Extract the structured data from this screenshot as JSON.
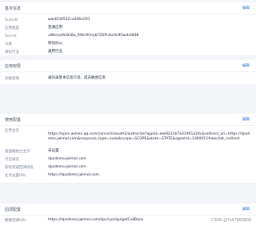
{
  "basic": {
    "title": "基本信息",
    "edit": "编辑",
    "rows": [
      {
        "label": "SuiteID",
        "value": "wwd0305S2ca046a591"
      },
      {
        "label": "应用类型",
        "value": "普通应用"
      },
      {
        "label": "Secret",
        "value": "uWerno9eDiiBo_ItWn9mnjkFZDPn4oHx9Ow4ct848"
      },
      {
        "label": "分类",
        "value": "移动办公"
      },
      {
        "label": "目标行业",
        "value": "通用行业"
      }
    ]
  },
  "permission": {
    "title": "应用权限",
    "edit": "编辑",
    "rows": [
      {
        "label": "功能权限",
        "value": "通讯录基本信息只读、成员敏感信息"
      }
    ]
  },
  "usage": {
    "title": "使用配置",
    "edit": "编辑",
    "rows": [
      {
        "label": "应用主页",
        "value": "https://open.weixin.qq.com/connect/oauth2/authorize?appid=ww9231b7a31901a24c&redirect_uri=https://dpsdemo.jwimol.com&response_type=code&scope=SCOPE&state=STATE&agentid=1000015#wechat_redirect"
      },
      {
        "label": "桌面端独立主页",
        "value": "未设置"
      },
      {
        "label": "可信域名",
        "value": "dpsdemo.jwimol.com"
      },
      {
        "label": "安装完成回调域名",
        "value": "dpsdemo.jwimol.com"
      },
      {
        "label": "业务设置URL",
        "value": "https://dpsdemo.jwimol.com"
      }
    ]
  },
  "callback": {
    "title": "回调配置",
    "edit": "编辑",
    "rows": [
      {
        "label": "数据回调URL",
        "value": "https://dpsdemo.jwimol.com/dpc/sys/api/getCallBack"
      }
    ]
  },
  "watermark": "CSDN @TzA7960800"
}
